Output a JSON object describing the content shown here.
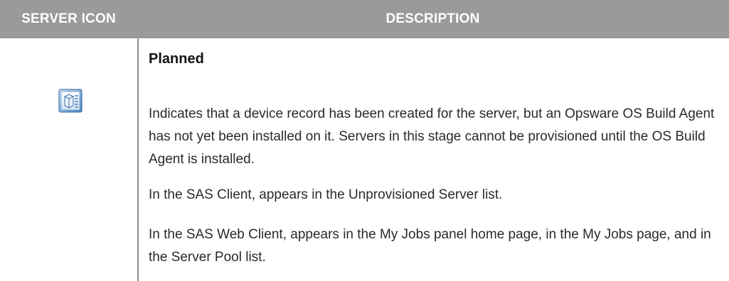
{
  "header": {
    "icon_column": "SERVER ICON",
    "description_column": "DESCRIPTION"
  },
  "row": {
    "icon": "server-planned-icon",
    "title": "Planned",
    "paragraphs": [
      "Indicates that a device record has been created for the server, but an Opsware OS Build Agent has not yet been installed on it. Servers in this stage cannot be provisioned until the OS Build Agent is installed.",
      "In the SAS Client, appears in the Unprovisioned Server list.",
      "In the SAS Web Client, appears in the My Jobs panel home page, in the My Jobs page, and in the Server Pool list."
    ]
  },
  "colors": {
    "header_background": "#9a9a9a",
    "header_text": "#ffffff",
    "divider": "#8f8f8f"
  }
}
